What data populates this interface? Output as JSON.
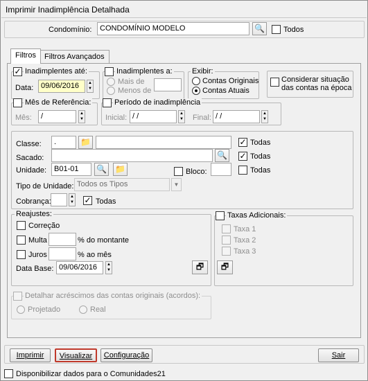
{
  "window": {
    "title": "Imprimir Inadimplência Detalhada"
  },
  "condominio": {
    "label": "Condomínio:",
    "value": "CONDOMÍNIO MODELO",
    "todos_label": "Todos",
    "todos_checked": false
  },
  "tabs": [
    {
      "label": "Filtros",
      "active": true
    },
    {
      "label": "Filtros Avançados",
      "active": false
    }
  ],
  "inadimplentes_ate": {
    "label": "Inadimplentes até:",
    "checked": true,
    "data_label": "Data:",
    "data_value": "09/06/2016"
  },
  "inadimplentes_a": {
    "label": "Inadimplentes a:",
    "checked": false,
    "mais_de": "Mais de",
    "menos_de": "Menos de"
  },
  "exibir": {
    "label": "Exibir:",
    "contas_originais": "Contas Originais",
    "contas_atuais": "Contas Atuais",
    "selected": "contas_atuais"
  },
  "considerar": {
    "label": "Considerar situação das contas na época",
    "checked": false
  },
  "mes_referencia": {
    "label": "Mês de Referência:",
    "checked": false,
    "mes_label": "Mês:",
    "mes_value": "  /"
  },
  "periodo": {
    "label": "Período de inadimplência",
    "checked": false,
    "inicial_label": "Inicial:",
    "inicial_value": " / /",
    "final_label": "Final:",
    "final_value": " / /"
  },
  "filtros": {
    "classe_label": "Classe:",
    "classe_value": ".",
    "classe_desc": "",
    "classe_todas": "Todas",
    "classe_todas_checked": true,
    "sacado_label": "Sacado:",
    "sacado_value": "",
    "sacado_todas": "Todas",
    "sacado_todas_checked": true,
    "unidade_label": "Unidade:",
    "unidade_value": "B01-01",
    "bloco_label": "Bloco:",
    "bloco_value": "",
    "unidade_todas": "Todas",
    "unidade_todas_checked": false,
    "tipo_label": "Tipo de Unidade:",
    "tipo_value": "Todos os Tipos",
    "cobranca_label": "Cobrança:",
    "cobranca_value": "",
    "cobranca_todas": "Todas",
    "cobranca_todas_checked": true
  },
  "reajustes": {
    "label": "Reajustes:",
    "correcao": "Correção",
    "multa": "Multa",
    "multa_suffix": "% do montante",
    "juros": "Juros",
    "juros_suffix": "% ao mês",
    "data_base_label": "Data Base:",
    "data_base_value": "09/06/2016"
  },
  "taxas": {
    "label": "Taxas Adicionais:",
    "taxa1": "Taxa 1",
    "taxa2": "Taxa 2",
    "taxa3": "Taxa 3"
  },
  "detalhar": {
    "label": "Detalhar acréscimos das contas originais (acordos):",
    "projetado": "Projetado",
    "real": "Real"
  },
  "buttons": {
    "imprimir": "Imprimir",
    "visualizar": "Visualizar",
    "configuracao": "Configuração",
    "sair": "Sair"
  },
  "footer": {
    "disponibilizar": "Disponibilizar dados para o Comunidades21",
    "checked": false
  },
  "colors": {
    "focus_border": "#c0392b",
    "date_highlight": "#ffffc8"
  }
}
